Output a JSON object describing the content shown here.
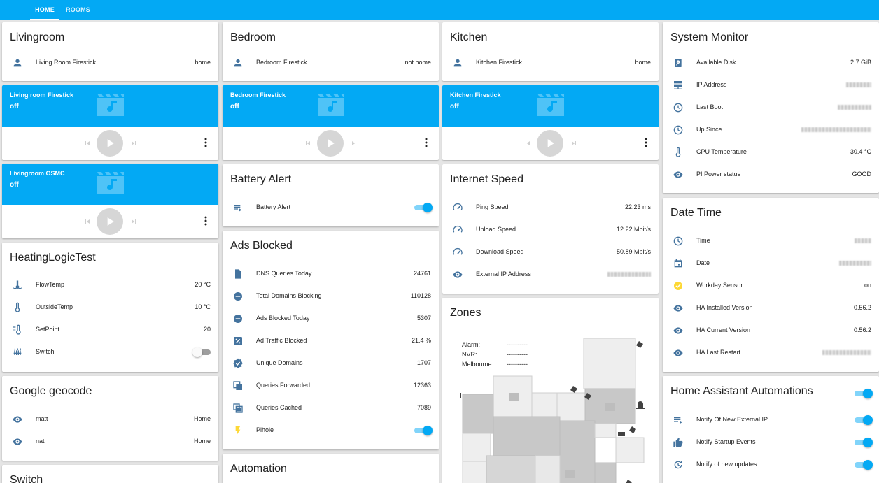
{
  "tabs": {
    "home": "HOME",
    "rooms": "ROOMS"
  },
  "livingroom": {
    "title": "Livingroom",
    "rows": [
      {
        "label": "Living Room Firestick",
        "value": "home"
      }
    ]
  },
  "media_living_firestick": {
    "name": "Living room Firestick",
    "state": "off"
  },
  "media_living_osmc": {
    "name": "Livingroom OSMC",
    "state": "off"
  },
  "heating": {
    "title": "HeatingLogicTest",
    "rows": [
      {
        "label": "FlowTemp",
        "value": "20 °C"
      },
      {
        "label": "OutsideTemp",
        "value": "10 °C"
      },
      {
        "label": "SetPoint",
        "value": "20"
      },
      {
        "label": "Switch",
        "value": ""
      }
    ]
  },
  "geocode": {
    "title": "Google geocode",
    "rows": [
      {
        "label": "matt",
        "value": "Home"
      },
      {
        "label": "nat",
        "value": "Home"
      }
    ]
  },
  "switch_card": {
    "title": "Switch"
  },
  "bedroom": {
    "title": "Bedroom",
    "rows": [
      {
        "label": "Bedroom Firestick",
        "value": "not home"
      }
    ]
  },
  "media_bedroom": {
    "name": "Bedroom Firestick",
    "state": "off"
  },
  "battery": {
    "title": "Battery Alert",
    "rows": [
      {
        "label": "Battery Alert"
      }
    ]
  },
  "ads": {
    "title": "Ads Blocked",
    "rows": [
      {
        "label": "DNS Queries Today",
        "value": "24761"
      },
      {
        "label": "Total Domains Blocking",
        "value": "110128"
      },
      {
        "label": "Ads Blocked Today",
        "value": "5307"
      },
      {
        "label": "Ad Traffic Blocked",
        "value": "21.4 %"
      },
      {
        "label": "Unique Domains",
        "value": "1707"
      },
      {
        "label": "Queries Forwarded",
        "value": "12363"
      },
      {
        "label": "Queries Cached",
        "value": "7089"
      },
      {
        "label": "Pihole"
      }
    ]
  },
  "automation": {
    "title": "Automation"
  },
  "kitchen": {
    "title": "Kitchen",
    "rows": [
      {
        "label": "Kitchen Firestick",
        "value": "home"
      }
    ]
  },
  "media_kitchen": {
    "name": "Kitchen Firestick",
    "state": "off"
  },
  "internet": {
    "title": "Internet Speed",
    "rows": [
      {
        "label": "Ping Speed",
        "value": "22.23 ms"
      },
      {
        "label": "Upload Speed",
        "value": "12.22 Mbit/s"
      },
      {
        "label": "Download Speed",
        "value": "50.89 Mbit/s"
      },
      {
        "label": "External IP Address",
        "value": ""
      }
    ]
  },
  "zones": {
    "title": "Zones",
    "labels": [
      {
        "k": "Alarm:",
        "v": "----------"
      },
      {
        "k": "NVR:",
        "v": "----------"
      },
      {
        "k": "Melbourne:",
        "v": "----------"
      }
    ]
  },
  "sysmon": {
    "title": "System Monitor",
    "rows": [
      {
        "label": "Available Disk",
        "value": "2.7 GiB"
      },
      {
        "label": "IP Address",
        "value": ""
      },
      {
        "label": "Last Boot",
        "value": ""
      },
      {
        "label": "Up Since",
        "value": ""
      },
      {
        "label": "CPU Temperature",
        "value": "30.4 °C"
      },
      {
        "label": "PI Power status",
        "value": "GOOD"
      }
    ]
  },
  "datetime": {
    "title": "Date Time",
    "rows": [
      {
        "label": "Time",
        "value": ""
      },
      {
        "label": "Date",
        "value": ""
      },
      {
        "label": "Workday Sensor",
        "value": "on"
      },
      {
        "label": "HA Installed Version",
        "value": "0.56.2"
      },
      {
        "label": "HA Current Version",
        "value": "0.56.2"
      },
      {
        "label": "HA Last Restart",
        "value": ""
      }
    ]
  },
  "automations": {
    "title": "Home Assistant Automations",
    "rows": [
      {
        "label": "Notify Of New External IP"
      },
      {
        "label": "Notify Startup Events"
      },
      {
        "label": "Notify of new updates"
      }
    ]
  },
  "colors": {
    "primary": "#03a9f4",
    "icon": "#44739e",
    "yellow": "#fdd835"
  }
}
